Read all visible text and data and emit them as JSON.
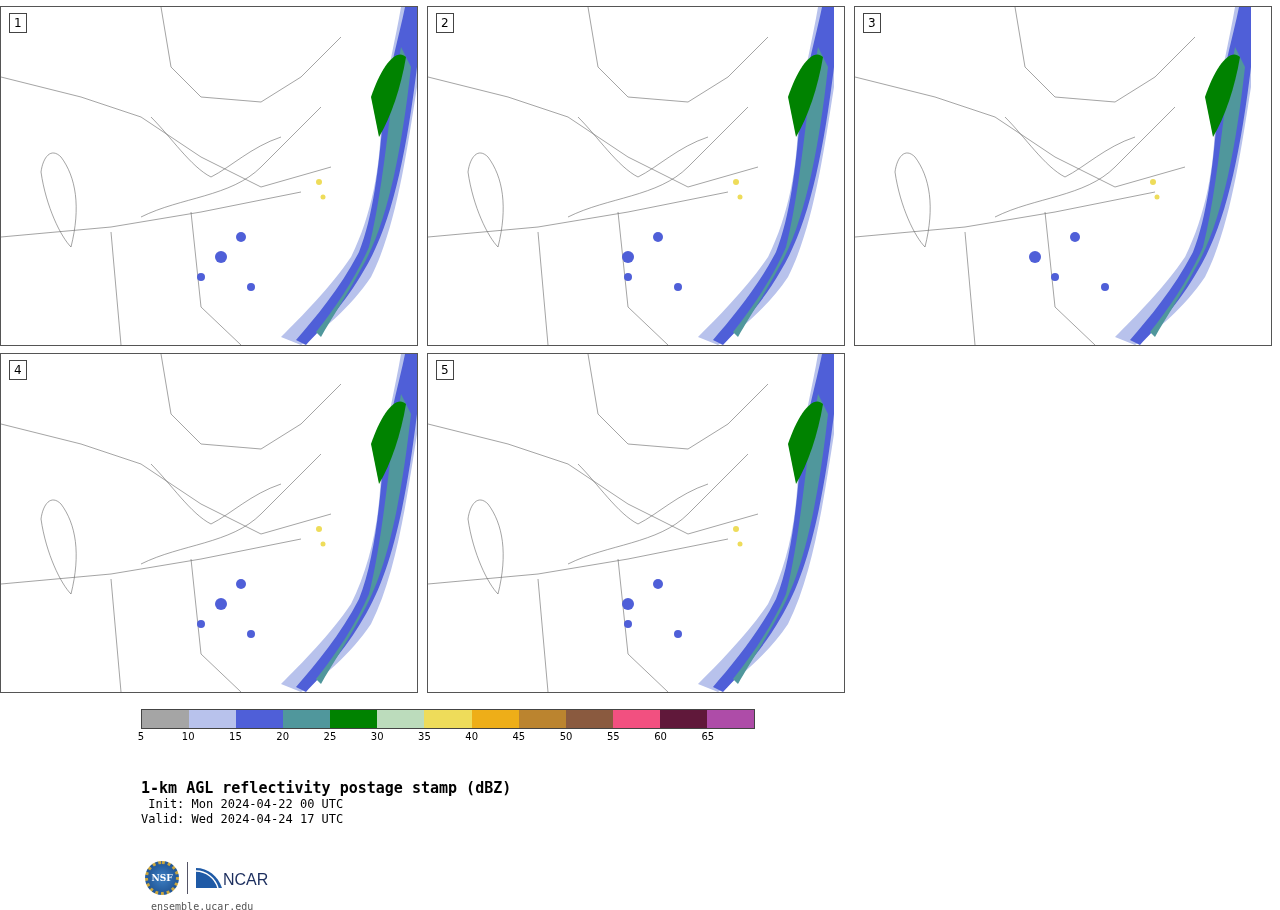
{
  "panels": [
    {
      "label": "1"
    },
    {
      "label": "2"
    },
    {
      "label": "3"
    },
    {
      "label": "4"
    },
    {
      "label": "5"
    }
  ],
  "colorbar": {
    "bins": [
      {
        "label": "5",
        "color": "#a5a5a5"
      },
      {
        "label": "10",
        "color": "#b8c2ec"
      },
      {
        "label": "15",
        "color": "#4f5fd8"
      },
      {
        "label": "20",
        "color": "#50979c"
      },
      {
        "label": "25",
        "color": "#008200"
      },
      {
        "label": "30",
        "color": "#bcdcbc"
      },
      {
        "label": "35",
        "color": "#eedc5a"
      },
      {
        "label": "40",
        "color": "#eeae18"
      },
      {
        "label": "45",
        "color": "#bb842f"
      },
      {
        "label": "50",
        "color": "#8a5a3f"
      },
      {
        "label": "55",
        "color": "#f25080"
      },
      {
        "label": "60",
        "color": "#60183a"
      },
      {
        "label": "65",
        "color": "#ae4ca8"
      }
    ]
  },
  "title": "1-km AGL reflectivity postage stamp (dBZ)",
  "init": " Init: Mon 2024-04-22 00 UTC",
  "valid": "Valid: Wed 2024-04-24 17 UTC",
  "logos": {
    "nsf": "NSF",
    "ncar": "NCAR"
  },
  "footer": "ensemble.ucar.edu"
}
